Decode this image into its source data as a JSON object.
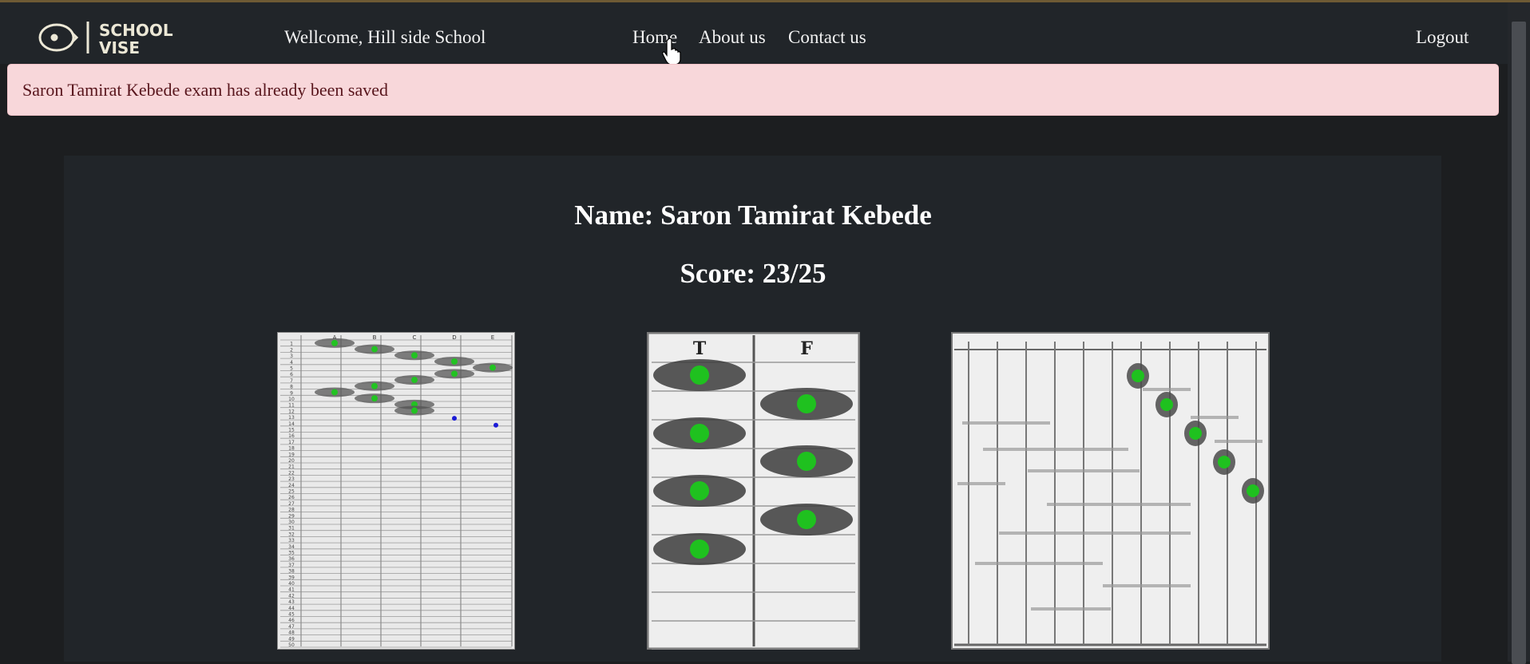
{
  "brand": {
    "logo_text_line1": "SCHOOL",
    "logo_text_line2": "VISE"
  },
  "nav": {
    "welcome": "Wellcome, Hill side School",
    "links": [
      "Home",
      "About us",
      "Contact us"
    ],
    "logout": "Logout"
  },
  "alert": {
    "message": "Saron Tamirat Kebede exam has already been saved"
  },
  "result": {
    "name": "Name: Saron Tamirat Kebede",
    "score": "Score: 23/25"
  },
  "sheets": [
    {
      "kind": "multiple-choice answer grid",
      "columns": [
        "A",
        "B",
        "C",
        "D",
        "E"
      ],
      "rows": 50,
      "marked_row_answers": {
        "1": "A",
        "2": "B",
        "3": "C",
        "4": "D",
        "5": "E",
        "6": "D",
        "7": "C",
        "8": "B",
        "9": "A",
        "10": "B",
        "11": "C",
        "12": "C"
      },
      "correct_mark_color": "#22c322",
      "incorrect_mark_color": "#1b1bd6"
    },
    {
      "kind": "true/false answer grid",
      "columns": [
        "T",
        "F"
      ]
    },
    {
      "kind": "matching answer grid"
    }
  ],
  "colors": {
    "navbar": "#212529",
    "page": "#1c1e20",
    "alert_bg": "#f8d7da",
    "alert_text": "#58151c"
  }
}
